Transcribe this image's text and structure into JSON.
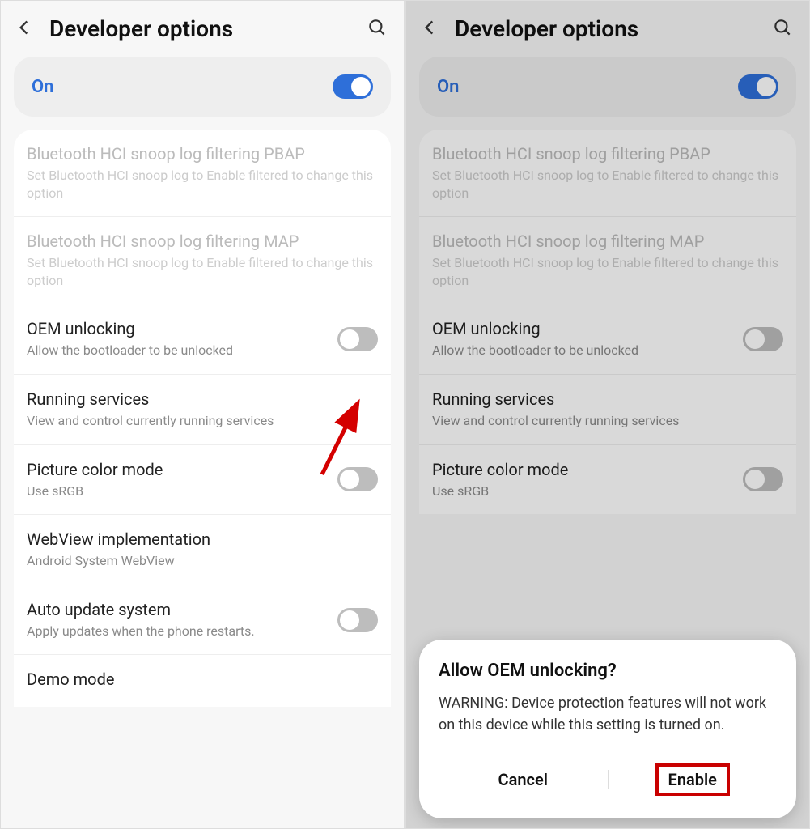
{
  "header": {
    "title": "Developer options"
  },
  "master": {
    "label": "On",
    "state": "on"
  },
  "items": [
    {
      "title": "Bluetooth HCI snoop log filtering PBAP",
      "sub": "Set Bluetooth HCI snoop log to Enable filtered to change this option",
      "disabled": true
    },
    {
      "title": "Bluetooth HCI snoop log filtering MAP",
      "sub": "Set Bluetooth HCI snoop log to Enable filtered to change this option",
      "disabled": true
    },
    {
      "title": "OEM unlocking",
      "sub": "Allow the bootloader to be unlocked",
      "toggle": "off"
    },
    {
      "title": "Running services",
      "sub": "View and control currently running services"
    },
    {
      "title": "Picture color mode",
      "sub": "Use sRGB",
      "toggle": "off"
    },
    {
      "title": "WebView implementation",
      "sub": "Android System WebView"
    },
    {
      "title": "Auto update system",
      "sub": "Apply updates when the phone restarts.",
      "toggle": "off"
    },
    {
      "title": "Demo mode",
      "sub": ""
    }
  ],
  "dialog": {
    "title": "Allow OEM unlocking?",
    "body": "WARNING: Device protection features will not work on this device while this setting is turned on.",
    "cancel": "Cancel",
    "enable": "Enable"
  }
}
